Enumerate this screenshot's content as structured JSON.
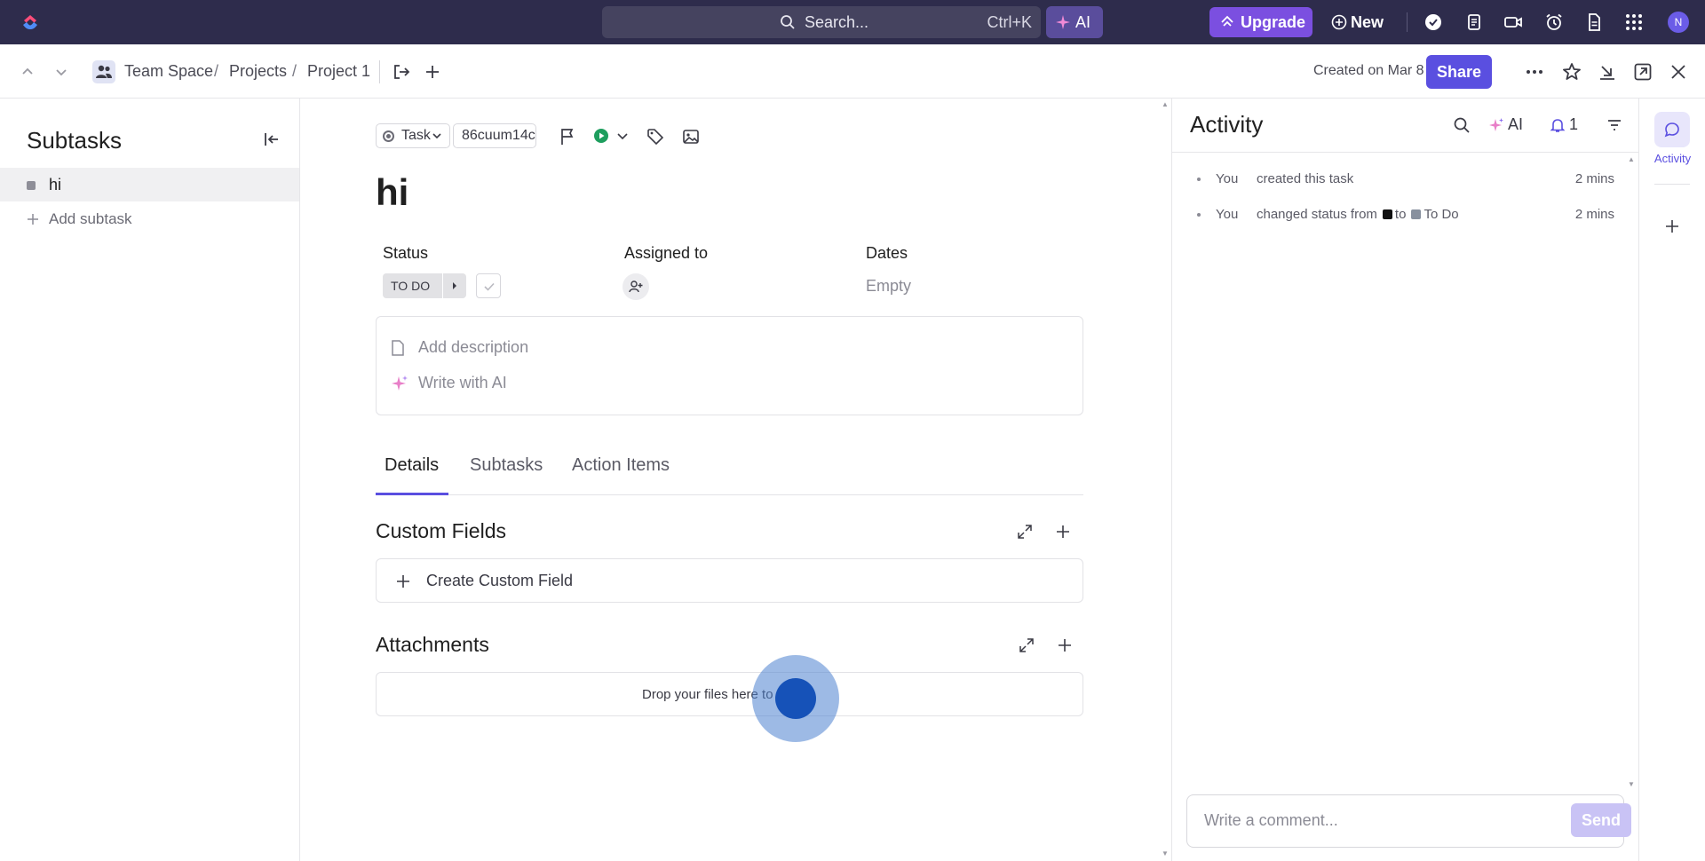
{
  "topbar": {
    "search_placeholder": "Search...",
    "search_shortcut": "Ctrl+K",
    "ai_label": "AI",
    "upgrade_label": "Upgrade",
    "new_label": "New",
    "avatar_initial": "N"
  },
  "header": {
    "breadcrumb": [
      "Team Space",
      "Projects",
      "Project 1"
    ],
    "breadcrumb_sep": "/",
    "created": "Created on Mar 8",
    "share_label": "Share"
  },
  "sidebar": {
    "title": "Subtasks",
    "items": [
      {
        "label": "hi"
      }
    ],
    "add_label": "Add subtask"
  },
  "task": {
    "type_label": "Task",
    "id": "86cuum14c",
    "title": "hi",
    "fields": {
      "status_label": "Status",
      "status_value": "TO DO",
      "assigned_label": "Assigned to",
      "dates_label": "Dates",
      "dates_value": "Empty"
    },
    "description_placeholder": "Add description",
    "write_ai_label": "Write with AI",
    "tabs": [
      "Details",
      "Subtasks",
      "Action Items"
    ],
    "active_tab": "Details",
    "custom_fields_title": "Custom Fields",
    "create_custom_field": "Create Custom Field",
    "attachments_title": "Attachments",
    "drop_text": "Drop your files here to"
  },
  "activity": {
    "title": "Activity",
    "ai_label": "AI",
    "notification_count": "1",
    "entries": [
      {
        "who": "You",
        "what": "created this task",
        "time": "2 mins"
      },
      {
        "who": "You",
        "what": "changed status from",
        "to_word": "to",
        "to_status": "To Do",
        "time": "2 mins"
      }
    ],
    "status_colors": {
      "from": "#111111",
      "to": "#87909e"
    },
    "comment_placeholder": "Write a comment...",
    "send_label": "Send"
  },
  "rail": {
    "activity_label": "Activity"
  },
  "colors": {
    "topbar": "#2e2c4c",
    "accent": "#5a4fe0",
    "upgrade": "#7b4fe0"
  }
}
